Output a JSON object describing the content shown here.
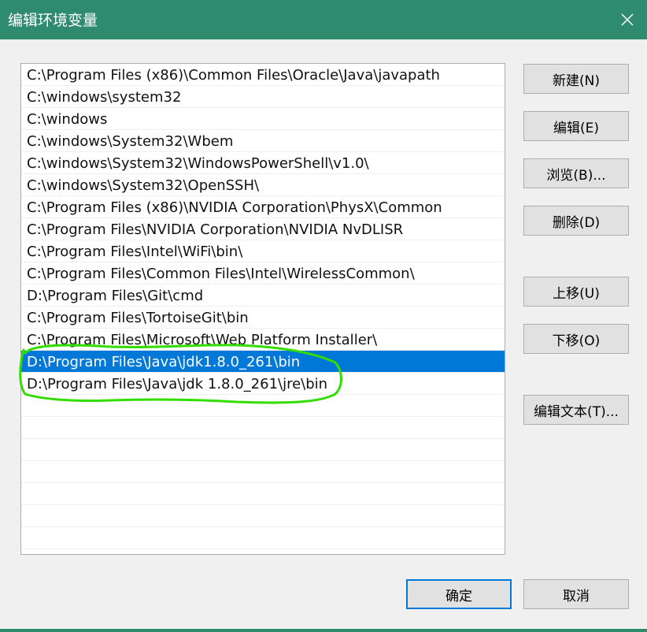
{
  "window": {
    "title": "编辑环境变量",
    "accent_color": "#2e8b6e",
    "selection_color": "#0078d7",
    "annotation_color": "#33dd00"
  },
  "list": {
    "items": [
      "C:\\Program Files (x86)\\Common Files\\Oracle\\Java\\javapath",
      "C:\\windows\\system32",
      "C:\\windows",
      "C:\\windows\\System32\\Wbem",
      "C:\\windows\\System32\\WindowsPowerShell\\v1.0\\",
      "C:\\windows\\System32\\OpenSSH\\",
      "C:\\Program Files (x86)\\NVIDIA Corporation\\PhysX\\Common",
      "C:\\Program Files\\NVIDIA Corporation\\NVIDIA NvDLISR",
      "C:\\Program Files\\Intel\\WiFi\\bin\\",
      "C:\\Program Files\\Common Files\\Intel\\WirelessCommon\\",
      "D:\\Program Files\\Git\\cmd",
      "C:\\Program Files\\TortoiseGit\\bin",
      "C:\\Program Files\\Microsoft\\Web Platform Installer\\",
      "D:\\Program Files\\Java\\jdk1.8.0_261\\bin",
      "D:\\Program Files\\Java\\jdk 1.8.0_261\\jre\\bin"
    ],
    "selected_index": 13
  },
  "buttons": {
    "new": "新建(N)",
    "edit": "编辑(E)",
    "browse": "浏览(B)...",
    "delete": "删除(D)",
    "move_up": "上移(U)",
    "move_down": "下移(O)",
    "edit_text": "编辑文本(T)...",
    "ok": "确定",
    "cancel": "取消"
  },
  "icons": {
    "close": "close-icon"
  }
}
